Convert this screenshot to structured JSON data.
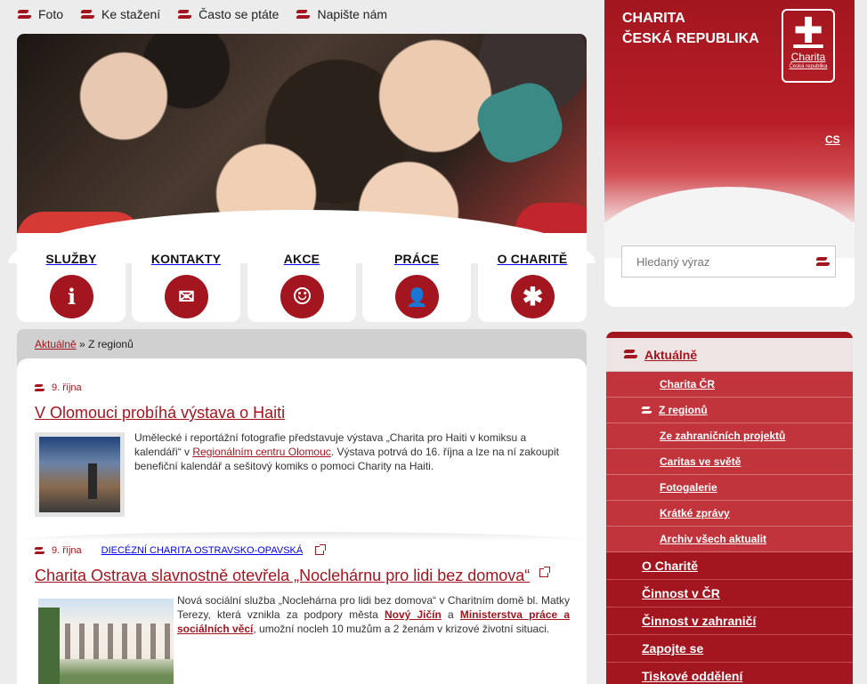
{
  "top_links": [
    {
      "label": "Foto"
    },
    {
      "label": "Ke stažení"
    },
    {
      "label": "Často se ptáte"
    },
    {
      "label": "Napište nám"
    }
  ],
  "brand": {
    "title_line1": "CHARITA",
    "title_line2": "ČESKÁ REPUBLIKA",
    "logo_text": "Charita",
    "logo_subtext": "Česká republika",
    "language": "CS"
  },
  "search": {
    "placeholder": "Hledaný výraz"
  },
  "nav_tiles": [
    {
      "label": "SLUŽBY",
      "icon": "info-icon",
      "glyph": "i"
    },
    {
      "label": "KONTAKTY",
      "icon": "envelope-icon",
      "glyph": "✉"
    },
    {
      "label": "AKCE",
      "icon": "masks-icon",
      "glyph": "☺"
    },
    {
      "label": "PRÁCE",
      "icon": "person-icon",
      "glyph": "👤"
    },
    {
      "label": "O CHARITĚ",
      "icon": "charita-cross-icon",
      "glyph": "✱"
    }
  ],
  "breadcrumb": {
    "link": "Aktuálně",
    "separator": "»",
    "current": "Z regionů"
  },
  "articles": [
    {
      "date": "9. října",
      "title": "V Olomouci probíhá výstava o Haiti",
      "text_before": "Umělecké i reportážní fotografie představuje výstava „Charita pro Haiti v komiksu a kalendáři“ v ",
      "link1": "Regionálním centru Olomouc",
      "text_after": ". Výstava potrvá do 16. října a lze na ní zakoupit benefiční kalendář a sešitový komiks o pomoci Charity na Haiti."
    },
    {
      "date": "9. října",
      "source": "DIECÉZNÍ CHARITA OSTRAVSKO-OPAVSKÁ",
      "title": "Charita Ostrava slavnostně otevřela „Noclehárnu pro lidi bez domova“",
      "text_before": "Nová sociální služba „Noclehárna pro lidi bez domova“ v Charitním domě bl. Matky Terezy, která vznikla za podpory města ",
      "link1": "Nový Jičín",
      "text_mid": " a ",
      "link2": "Ministerstva práce a sociálních věcí",
      "text_after": ", umožní nocleh 10 mužům a 2 ženám v krizové životní situaci."
    }
  ],
  "side_menu": {
    "active": "Aktuálně",
    "sub_items": [
      "Charita ČR",
      "Z regionů",
      "Ze zahraničních projektů",
      "Caritas ve světě",
      "Fotogalerie",
      "Krátké zprávy",
      "Archiv všech aktualit"
    ],
    "items": [
      "O Charitě",
      "Činnost v ČR",
      "Činnost v zahraničí",
      "Zapojte se",
      "Tiskové oddělení"
    ]
  },
  "colors": {
    "brand_red": "#a3161f",
    "sub_menu_red": "#c1343c",
    "active_bg": "#efe4e4"
  }
}
